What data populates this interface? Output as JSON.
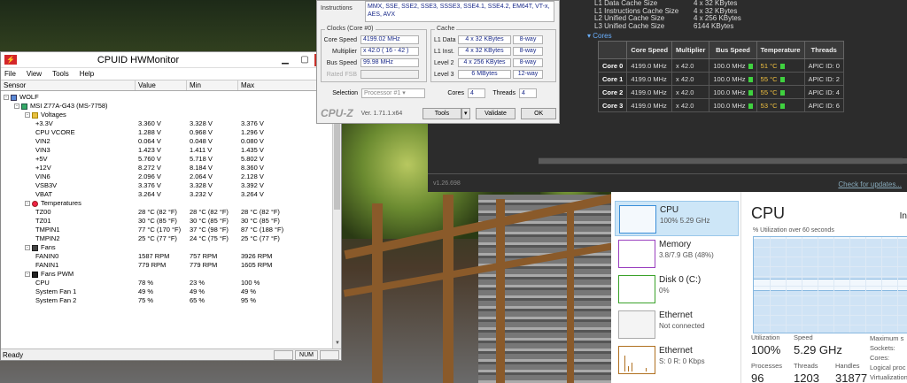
{
  "hwmonitor": {
    "title": "CPUID HWMonitor",
    "menu": [
      "File",
      "View",
      "Tools",
      "Help"
    ],
    "columns": [
      "Sensor",
      "Value",
      "Min",
      "Max"
    ],
    "rows": [
      {
        "name": "WOLF",
        "value": "",
        "min": "",
        "max": "",
        "level": 0,
        "icon": "computer-icon",
        "toggle": "-"
      },
      {
        "name": "MSI Z77A-G43 (MS-7758)",
        "value": "",
        "min": "",
        "max": "",
        "level": 1,
        "icon": "motherboard-icon",
        "toggle": "-"
      },
      {
        "name": "Voltages",
        "value": "",
        "min": "",
        "max": "",
        "level": 2,
        "icon": "voltage-icon",
        "toggle": "-"
      },
      {
        "name": "+3.3V",
        "value": "3.360 V",
        "min": "3.328 V",
        "max": "3.376 V",
        "level": 3
      },
      {
        "name": "CPU VCORE",
        "value": "1.288 V",
        "min": "0.968 V",
        "max": "1.296 V",
        "level": 3
      },
      {
        "name": "VIN2",
        "value": "0.064 V",
        "min": "0.048 V",
        "max": "0.080 V",
        "level": 3
      },
      {
        "name": "VIN3",
        "value": "1.423 V",
        "min": "1.411 V",
        "max": "1.435 V",
        "level": 3
      },
      {
        "name": "+5V",
        "value": "5.760 V",
        "min": "5.718 V",
        "max": "5.802 V",
        "level": 3
      },
      {
        "name": "+12V",
        "value": "8.272 V",
        "min": "8.184 V",
        "max": "8.360 V",
        "level": 3
      },
      {
        "name": "VIN6",
        "value": "2.096 V",
        "min": "2.064 V",
        "max": "2.128 V",
        "level": 3
      },
      {
        "name": "VSB3V",
        "value": "3.376 V",
        "min": "3.328 V",
        "max": "3.392 V",
        "level": 3
      },
      {
        "name": "VBAT",
        "value": "3.264 V",
        "min": "3.232 V",
        "max": "3.264 V",
        "level": 3
      },
      {
        "name": "Temperatures",
        "value": "",
        "min": "",
        "max": "",
        "level": 2,
        "icon": "thermometer-icon",
        "toggle": "-"
      },
      {
        "name": "TZ00",
        "value": "28 °C  (82 °F)",
        "min": "28 °C  (82 °F)",
        "max": "28 °C  (82 °F)",
        "level": 3
      },
      {
        "name": "TZ01",
        "value": "30 °C  (85 °F)",
        "min": "30 °C  (85 °F)",
        "max": "30 °C  (85 °F)",
        "level": 3
      },
      {
        "name": "TMPIN1",
        "value": "77 °C  (170 °F)",
        "min": "37 °C  (98 °F)",
        "max": "87 °C  (188 °F)",
        "level": 3
      },
      {
        "name": "TMPIN2",
        "value": "25 °C  (77 °F)",
        "min": "24 °C  (75 °F)",
        "max": "25 °C  (77 °F)",
        "level": 3
      },
      {
        "name": "Fans",
        "value": "",
        "min": "",
        "max": "",
        "level": 2,
        "icon": "fan-icon",
        "toggle": "-"
      },
      {
        "name": "FANIN0",
        "value": "1587 RPM",
        "min": "757 RPM",
        "max": "3926 RPM",
        "level": 3
      },
      {
        "name": "FANIN1",
        "value": "779 RPM",
        "min": "779 RPM",
        "max": "1605 RPM",
        "level": 3
      },
      {
        "name": "Fans PWM",
        "value": "",
        "min": "",
        "max": "",
        "level": 2,
        "icon": "fan-pwm-icon",
        "toggle": "-"
      },
      {
        "name": "CPU",
        "value": "78 %",
        "min": "23 %",
        "max": "100 %",
        "level": 3
      },
      {
        "name": "System Fan 1",
        "value": "49 %",
        "min": "49 %",
        "max": "49 %",
        "level": 3
      },
      {
        "name": "System Fan 2",
        "value": "75 %",
        "min": "65 %",
        "max": "95 %",
        "level": 3
      }
    ],
    "status": {
      "ready": "Ready",
      "num": "NUM"
    }
  },
  "cpuz": {
    "instructions_label": "Instructions",
    "instructions_value": "MMX, SSE, SSE2, SSE3, SSSE3, SSE4.1, SSE4.2, EM64T, VT-x, AES, AVX",
    "clocks_title": "Clocks (Core #0)",
    "clocks": [
      {
        "label": "Core Speed",
        "value": "4199.02 MHz",
        "dim": false
      },
      {
        "label": "Multiplier",
        "value": "x 42.0 ( 16 - 42 )",
        "dim": false
      },
      {
        "label": "Bus Speed",
        "value": "99.98 MHz",
        "dim": false
      },
      {
        "label": "Rated FSB",
        "value": "",
        "dim": true
      }
    ],
    "cache_title": "Cache",
    "cache": [
      {
        "label": "L1 Data",
        "size": "4 x 32 KBytes",
        "way": "8-way"
      },
      {
        "label": "L1 Inst.",
        "size": "4 x 32 KBytes",
        "way": "8-way"
      },
      {
        "label": "Level 2",
        "size": "4 x 256 KBytes",
        "way": "8-way"
      },
      {
        "label": "Level 3",
        "size": "6 MBytes",
        "way": "12-way"
      }
    ],
    "selection_label": "Selection",
    "selection_value": "Processor #1",
    "cores_label": "Cores",
    "cores_value": "4",
    "threads_label": "Threads",
    "threads_value": "4",
    "logo": "CPU-Z",
    "version": "Ver. 1.71.1.x64",
    "tools_label": "Tools",
    "validate_label": "Validate",
    "ok_label": "OK"
  },
  "cpuinfo": {
    "cache_lines": [
      {
        "k": "L1 Data Cache Size",
        "v": "4 x 32 KBytes"
      },
      {
        "k": "L1 Instructions Cache Size",
        "v": "4 x 32 KBytes"
      },
      {
        "k": "L2 Unified Cache Size",
        "v": "4 x 256 KBytes"
      },
      {
        "k": "L3 Unified Cache Size",
        "v": "6144 KBytes"
      }
    ],
    "cores_label": "Cores",
    "headers": [
      "",
      "Core Speed",
      "Multiplier",
      "Bus Speed",
      "Temperature",
      "Threads"
    ],
    "cores": [
      {
        "core": "Core 0",
        "speed": "4199.0 MHz",
        "mult": "x 42.0",
        "bus": "100.0 MHz",
        "temp": "51 °C",
        "threads": "APIC ID: 0"
      },
      {
        "core": "Core 1",
        "speed": "4199.0 MHz",
        "mult": "x 42.0",
        "bus": "100.0 MHz",
        "temp": "55 °C",
        "threads": "APIC ID: 2"
      },
      {
        "core": "Core 2",
        "speed": "4199.0 MHz",
        "mult": "x 42.0",
        "bus": "100.0 MHz",
        "temp": "55 °C",
        "threads": "APIC ID: 4"
      },
      {
        "core": "Core 3",
        "speed": "4199.0 MHz",
        "mult": "x 42.0",
        "bus": "100.0 MHz",
        "temp": "53 °C",
        "threads": "APIC ID: 6"
      }
    ],
    "version": "v1.26.698",
    "update_link": "Check for updates..."
  },
  "taskmanager": {
    "items": [
      {
        "t1": "CPU",
        "t2": "100%  5.29 GHz",
        "kind": "cpu"
      },
      {
        "t1": "Memory",
        "t2": "3.8/7.9 GB (48%)",
        "kind": "mem"
      },
      {
        "t1": "Disk 0 (C:)",
        "t2": "0%",
        "kind": "disk"
      },
      {
        "t1": "Ethernet",
        "t2": "Not connected",
        "kind": "eth1"
      },
      {
        "t1": "Ethernet",
        "t2": "S: 0  R: 0 Kbps",
        "kind": "eth2"
      }
    ],
    "title": "CPU",
    "title_right": "In",
    "util_label": "% Utilization over 60 seconds",
    "utilization_label": "Utilization",
    "utilization_value": "100%",
    "speed_label": "Speed",
    "speed_value": "5.29 GHz",
    "processes_label": "Processes",
    "processes_value": "96",
    "threads_label": "Threads",
    "threads_value": "1203",
    "handles_label": "Handles",
    "handles_value": "31877",
    "right_labels": [
      "Maximum s",
      "Sockets:",
      "Cores:",
      "Logical proc",
      "Virtualization"
    ]
  }
}
